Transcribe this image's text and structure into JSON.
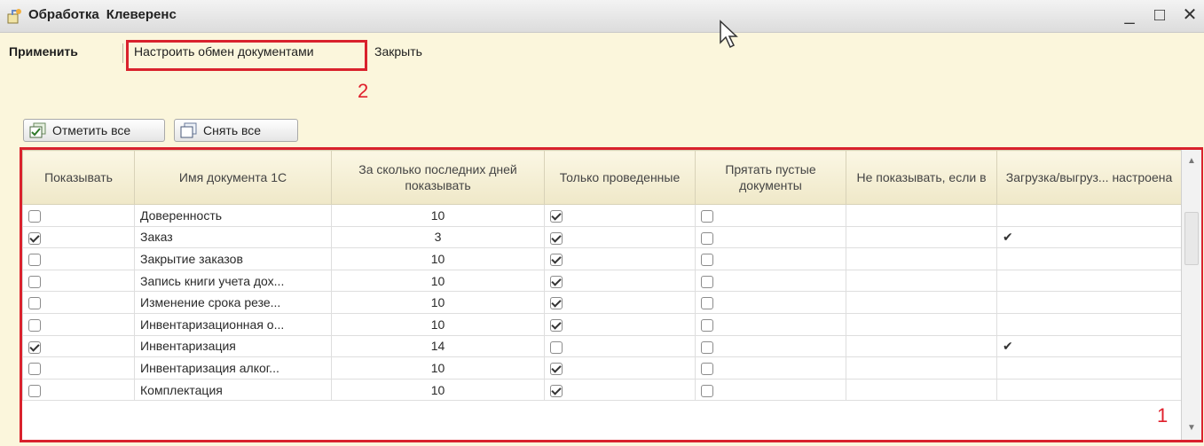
{
  "window": {
    "title_part1": "Обработка",
    "title_part2": "Клеверенс",
    "minimize": "_",
    "maximize": "□",
    "close": "✕"
  },
  "commands": {
    "apply": "Применить",
    "settings": "Настроить обмен документами",
    "close": "Закрыть"
  },
  "annotations": {
    "label1": "1",
    "label2": "2"
  },
  "buttons": {
    "check_all": "Отметить все",
    "uncheck_all": "Снять все"
  },
  "table": {
    "columns": [
      "Показывать",
      "Имя документа 1С",
      "За сколько последних дней показывать",
      "Только проведенные",
      "Прятать пустые документы",
      "Не показывать, если в",
      "Загрузка/выгруз... настроена"
    ],
    "rows": [
      {
        "show": false,
        "name": "Доверенность",
        "days": "10",
        "posted": true,
        "hide_empty": false,
        "not_show": "",
        "configured": ""
      },
      {
        "show": true,
        "name": "Заказ",
        "days": "3",
        "posted": true,
        "hide_empty": false,
        "not_show": "",
        "configured": "✔"
      },
      {
        "show": false,
        "name": "Закрытие заказов",
        "days": "10",
        "posted": true,
        "hide_empty": false,
        "not_show": "",
        "configured": ""
      },
      {
        "show": false,
        "name": "Запись книги учета дох...",
        "days": "10",
        "posted": true,
        "hide_empty": false,
        "not_show": "",
        "configured": ""
      },
      {
        "show": false,
        "name": "Изменение срока резе...",
        "days": "10",
        "posted": true,
        "hide_empty": false,
        "not_show": "",
        "configured": ""
      },
      {
        "show": false,
        "name": "Инвентаризационная о...",
        "days": "10",
        "posted": true,
        "hide_empty": false,
        "not_show": "",
        "configured": ""
      },
      {
        "show": true,
        "name": "Инвентаризация",
        "days": "14",
        "posted": false,
        "hide_empty": false,
        "not_show": "",
        "configured": "✔"
      },
      {
        "show": false,
        "name": "Инвентаризация алког...",
        "days": "10",
        "posted": true,
        "hide_empty": false,
        "not_show": "",
        "configured": ""
      },
      {
        "show": false,
        "name": "Комплектация",
        "days": "10",
        "posted": true,
        "hide_empty": false,
        "not_show": "",
        "configured": ""
      }
    ]
  },
  "colors": {
    "highlight": "#d9222d",
    "background": "#fbf6dc"
  }
}
